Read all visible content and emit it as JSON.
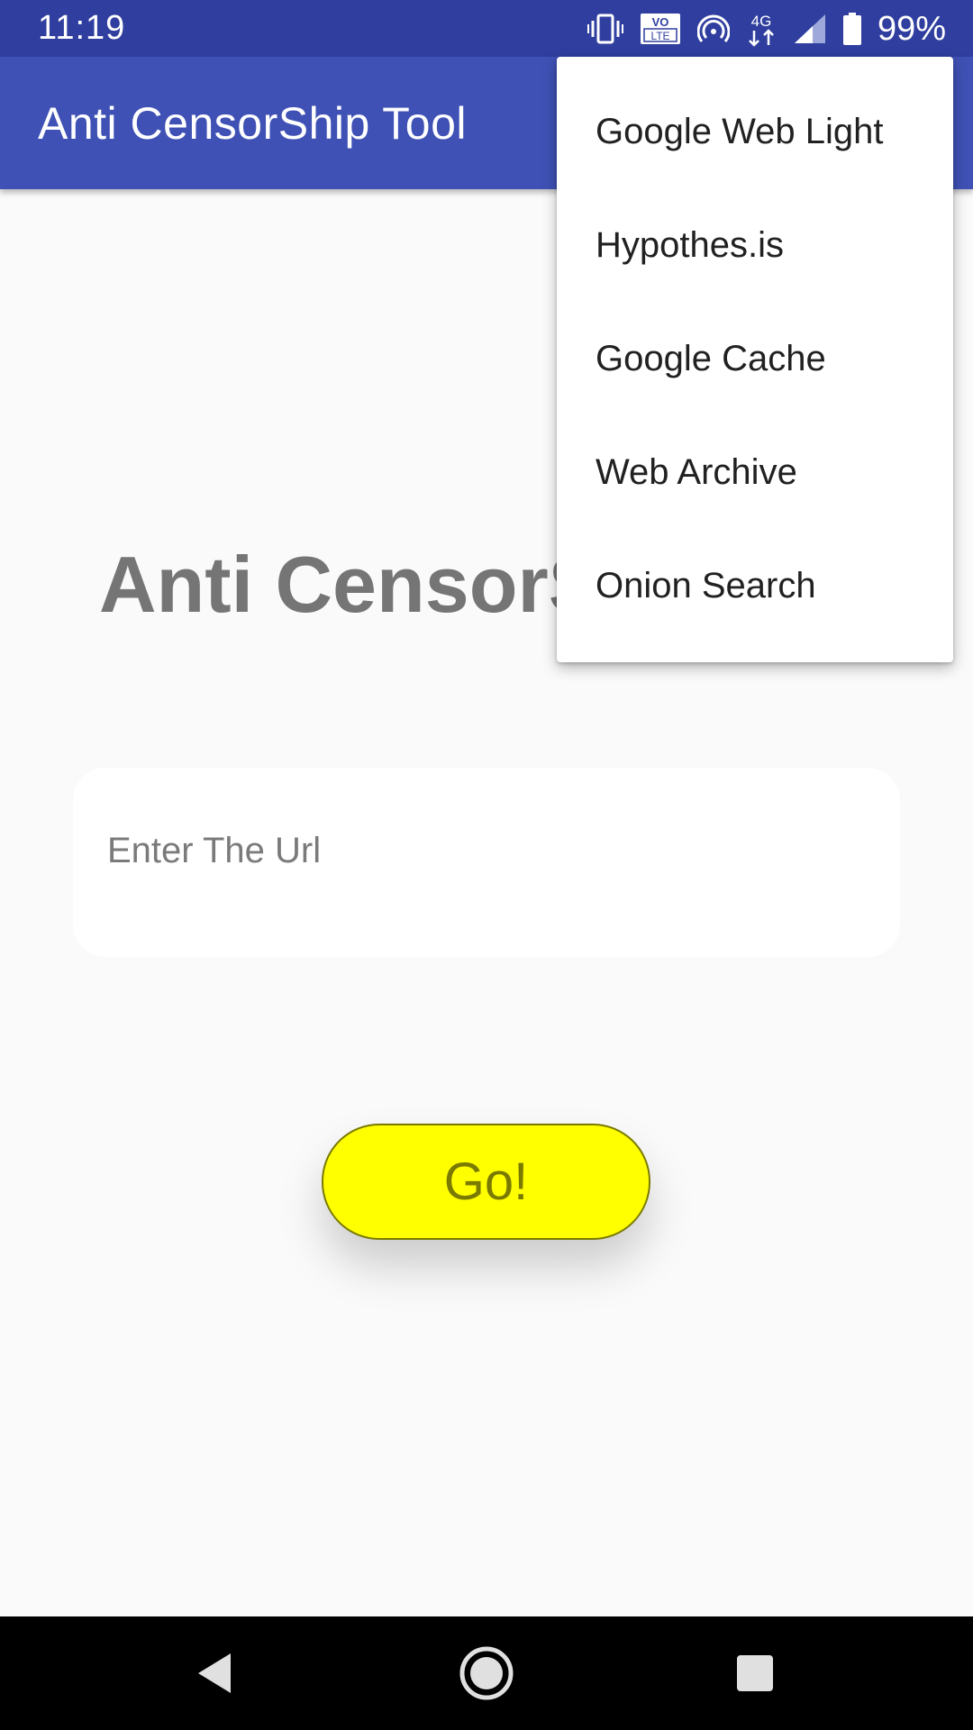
{
  "status_bar": {
    "time": "11:19",
    "battery": "99%",
    "icons": [
      "vibrate-icon",
      "volte-icon",
      "hotspot-icon",
      "network-4g-icon",
      "signal-icon",
      "battery-icon"
    ],
    "volte_text": "VO\nLTE",
    "network_text": "4G"
  },
  "app_bar": {
    "title": "Anti CensorShip Tool"
  },
  "main": {
    "heading": "Anti CensorShip Tool",
    "url_input": {
      "placeholder": "Enter The Url",
      "value": ""
    },
    "go_button_label": "Go!"
  },
  "menu": {
    "items": [
      {
        "label": "Google Web Light"
      },
      {
        "label": "Hypothes.is"
      },
      {
        "label": "Google Cache"
      },
      {
        "label": "Web Archive"
      },
      {
        "label": "Onion Search"
      }
    ]
  },
  "nav_bar": {
    "buttons": [
      "back-icon",
      "home-icon",
      "recents-icon"
    ]
  },
  "colors": {
    "status_bar": "#303f9f",
    "app_bar": "#3f51b5",
    "button": "#ffff00",
    "button_text": "#7a7a00",
    "heading": "#757575"
  }
}
